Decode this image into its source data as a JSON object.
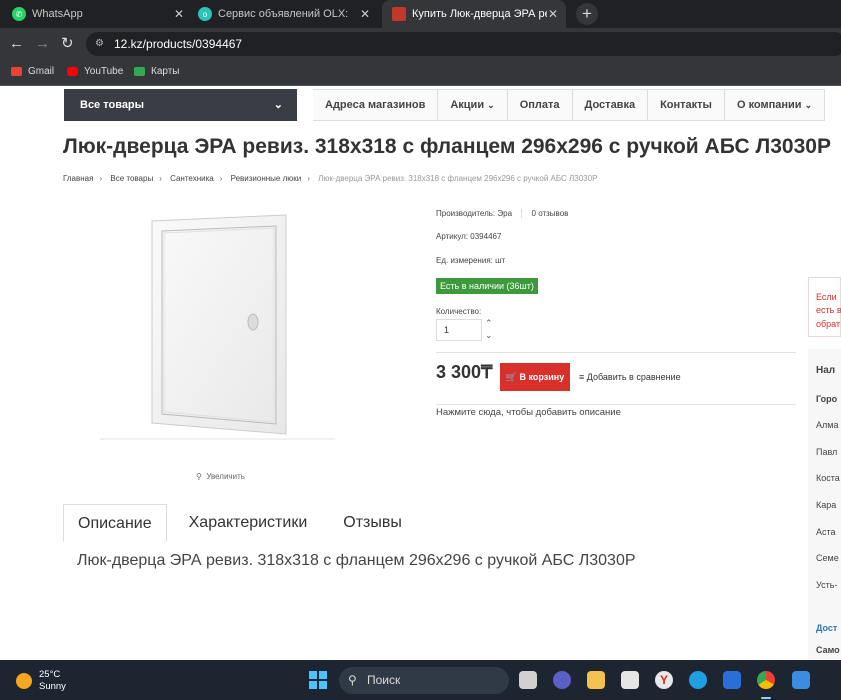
{
  "browser": {
    "tabs": [
      {
        "title": "WhatsApp",
        "icon": "whatsapp-icon",
        "color": "#25D366"
      },
      {
        "title": "Сервис объявлений OLX: сайт",
        "icon": "olx-icon",
        "color": "#2bc4b4"
      },
      {
        "title": "Купить Люк-дверца ЭРА ревиз",
        "icon": "12kz-icon",
        "color": "#c0392b"
      }
    ],
    "url": "12.kz/products/0394467",
    "bookmarks": [
      "Gmail",
      "YouTube",
      "Карты"
    ]
  },
  "site": {
    "all_goods": "Все товары",
    "menu": [
      "Адреса магазинов",
      "Акции",
      "Оплата",
      "Доставка",
      "Контакты",
      "О компании"
    ],
    "menu_has_dropdown": [
      false,
      true,
      false,
      false,
      false,
      true
    ]
  },
  "product": {
    "title": "Люк-дверца ЭРА ревиз. 318х318 с фланцем 296х296 с ручкой АБС Л3030Р",
    "breadcrumbs": [
      "Главная",
      "Все товары",
      "Сантехника",
      "Ревизионные люки",
      "Люк-дверца ЭРА ревиз. 318х318 с фланцем 296х296 с ручкой АБС Л3030Р"
    ],
    "zoom_label": "Увеличить",
    "manufacturer": "Производитель: Эра",
    "reviews": "0 отзывов",
    "article": "Артикул: 0394467",
    "unit": "Ед. измерения: шт",
    "stock": "Есть в наличии (36шт)",
    "qty_label": "Количество:",
    "qty_value": "1",
    "price": "3 300₸",
    "cart_button": "В корзину",
    "compare": "Добавить в сравнение",
    "add_desc": "Нажмите сюда, чтобы добавить описание",
    "tabs": [
      "Описание",
      "Характеристики",
      "Отзывы"
    ],
    "description": "Люк-дверца ЭРА ревиз. 318х318 с фланцем 296х296 с ручкой АБС Л3030Р"
  },
  "sidebar": {
    "notice": [
      "Если",
      "есть в",
      "обрат"
    ],
    "heading": "Нал",
    "city_header": "Горо",
    "cities": [
      "Алма",
      "Павл",
      "Коста",
      "Кара",
      "Аста",
      "Семе",
      "Усть-"
    ],
    "delivery": "Дост",
    "pickup": "Само"
  },
  "taskbar": {
    "temp": "25°C",
    "condition": "Sunny",
    "search": "Поиск"
  },
  "colors": {
    "stock_green": "#3c9a3c",
    "cart_red": "#d9302c",
    "menu_dark": "#3b3d45"
  }
}
